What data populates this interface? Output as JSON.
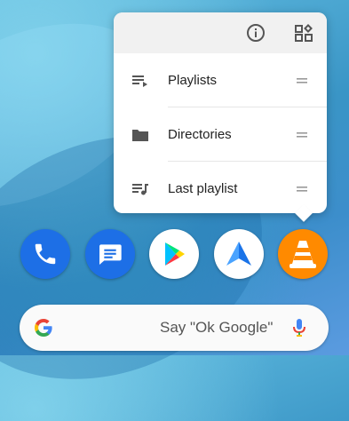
{
  "popup": {
    "items": [
      {
        "label": "Playlists",
        "icon": "playlist-icon"
      },
      {
        "label": "Directories",
        "icon": "folder-icon"
      },
      {
        "label": "Last playlist",
        "icon": "last-playlist-icon"
      }
    ]
  },
  "search": {
    "hint": "Say \"Ok Google\""
  },
  "dock": [
    "phone",
    "messages",
    "play-store",
    "android-auto",
    "vlc"
  ]
}
